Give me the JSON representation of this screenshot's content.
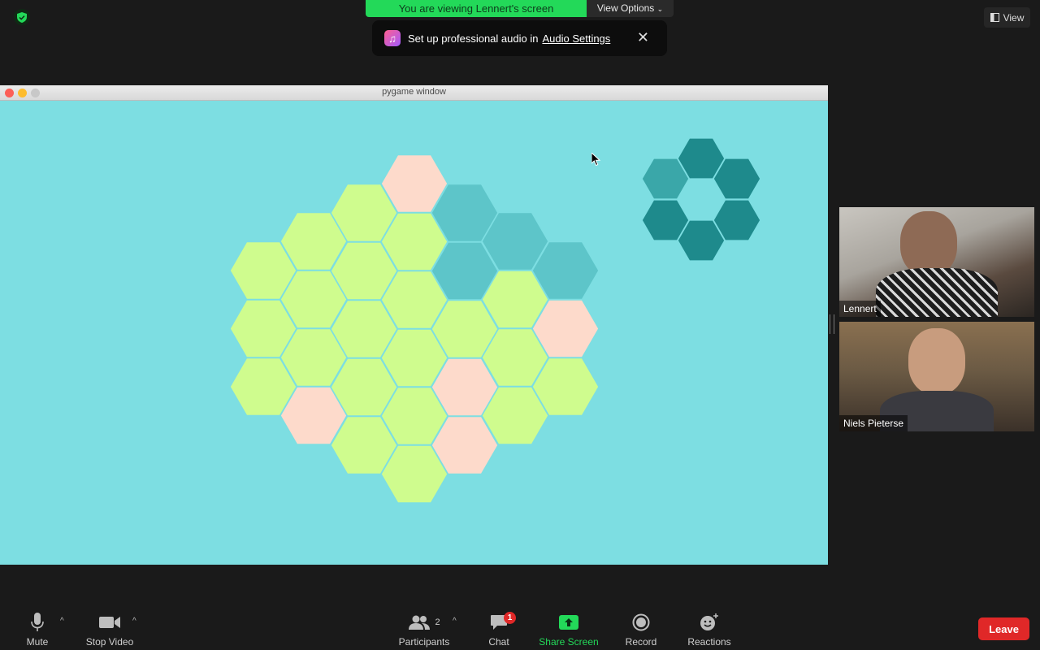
{
  "banner": {
    "share_text": "You are viewing Lennert's screen",
    "view_options_label": "View Options"
  },
  "toast": {
    "text": "Set up professional audio in",
    "link": "Audio Settings",
    "close_glyph": "✕"
  },
  "top_right": {
    "view_label": "View"
  },
  "game_window": {
    "title": "pygame window"
  },
  "game_board": {
    "colors": {
      "background": "#7ddee2",
      "green": "#cffc8e",
      "pink": "#fddacb",
      "teal_light": "#5dc5c9",
      "teal_dark": "#1e8a8c",
      "teal_mid": "#3aa7a9"
    }
  },
  "participants": [
    {
      "name": "Lennert"
    },
    {
      "name": "Niels Pieterse"
    }
  ],
  "toolbar": {
    "mute_label": "Mute",
    "video_label": "Stop Video",
    "participants_label": "Participants",
    "participants_count": "2",
    "chat_label": "Chat",
    "chat_badge": "1",
    "share_label": "Share Screen",
    "record_label": "Record",
    "reactions_label": "Reactions",
    "leave_label": "Leave"
  }
}
